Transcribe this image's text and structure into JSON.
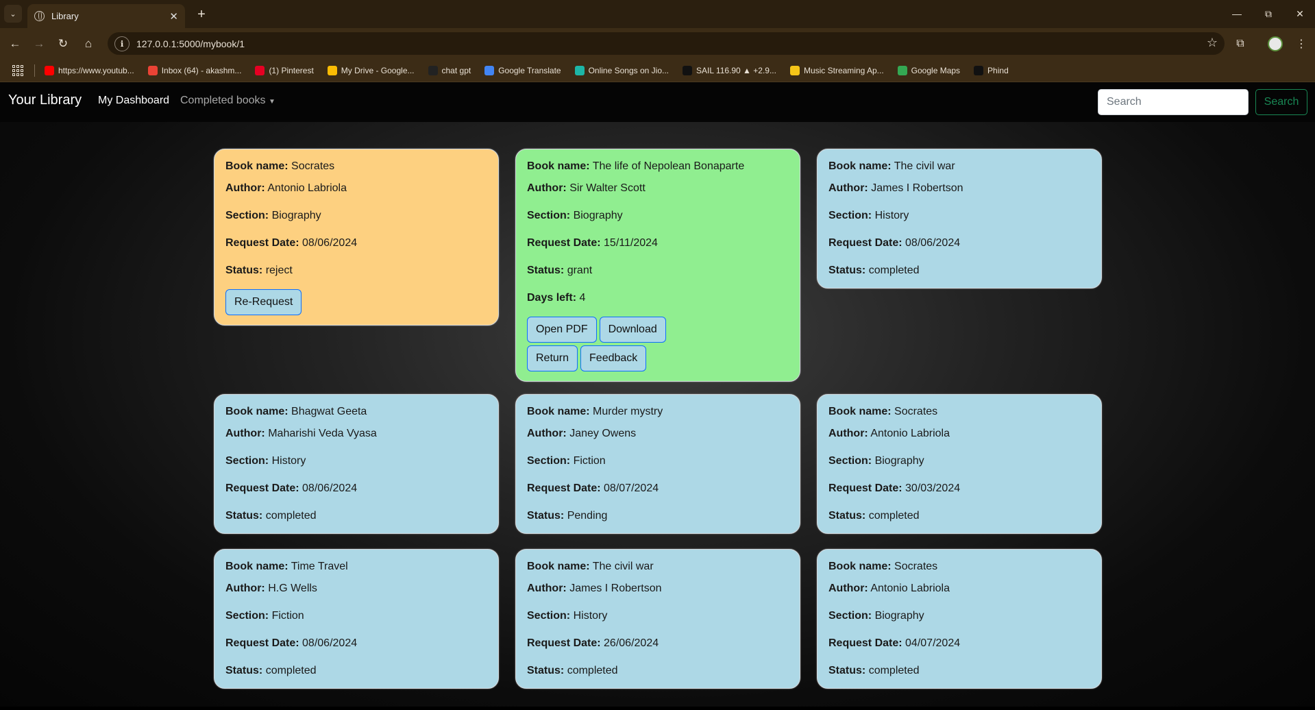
{
  "browser": {
    "tab_title": "Library",
    "url": "127.0.0.1:5000/mybook/1",
    "bookmarks": [
      {
        "label": "https://www.youtub...",
        "icon": "youtube-icon",
        "color": "#ff0000"
      },
      {
        "label": "Inbox (64) - akashm...",
        "icon": "gmail-icon",
        "color": "#ea4335"
      },
      {
        "label": "(1) Pinterest",
        "icon": "pinterest-icon",
        "color": "#e60023"
      },
      {
        "label": "My Drive - Google...",
        "icon": "drive-icon",
        "color": "#fbbc04"
      },
      {
        "label": "chat gpt",
        "icon": "chatgpt-icon",
        "color": "#222222"
      },
      {
        "label": "Google Translate",
        "icon": "translate-icon",
        "color": "#4285f4"
      },
      {
        "label": "Online Songs on Jio...",
        "icon": "jiosaavn-icon",
        "color": "#1db6a7"
      },
      {
        "label": "SAIL 116.90 ▲ +2.9...",
        "icon": "tradingview-icon",
        "color": "#111111"
      },
      {
        "label": "Music Streaming Ap...",
        "icon": "music-icon",
        "color": "#f5c518"
      },
      {
        "label": "Google Maps",
        "icon": "maps-icon",
        "color": "#34a853"
      },
      {
        "label": "Phind",
        "icon": "phind-icon",
        "color": "#111111"
      }
    ]
  },
  "navbar": {
    "brand": "Your Library",
    "dashboard": "My Dashboard",
    "completed": "Completed books",
    "search_placeholder": "Search",
    "search_button": "Search"
  },
  "labels": {
    "book_name": "Book name:",
    "author": "Author:",
    "section": "Section:",
    "request_date": "Request Date:",
    "status": "Status:",
    "days_left": "Days left:"
  },
  "colors": {
    "reject": "#fdd080",
    "grant": "#90ee90",
    "completed": "#add8e6"
  },
  "cards": [
    {
      "book": "Socrates",
      "author": "Antonio Labriola",
      "section": "Biography",
      "date": "08/06/2024",
      "status": "reject",
      "button": "Re-Request"
    },
    {
      "book": "The life of Nepolean Bonaparte",
      "author": "Sir Walter Scott",
      "section": "Biography",
      "date": "15/11/2024",
      "status": "grant",
      "days_left": "4",
      "buttons": [
        "Open PDF",
        "Download",
        "Return",
        "Feedback"
      ]
    },
    {
      "book": "The civil war",
      "author": "James I Robertson",
      "section": "History",
      "date": "08/06/2024",
      "status": "completed"
    },
    {
      "book": "Bhagwat Geeta",
      "author": "Maharishi Veda Vyasa",
      "section": "History",
      "date": "08/06/2024",
      "status": "completed"
    },
    {
      "book": "Murder mystry",
      "author": "Janey Owens",
      "section": "Fiction",
      "date": "08/07/2024",
      "status": "Pending"
    },
    {
      "book": "Socrates",
      "author": "Antonio Labriola",
      "section": "Biography",
      "date": "30/03/2024",
      "status": "completed"
    },
    {
      "book": "Time Travel",
      "author": "H.G Wells",
      "section": "Fiction",
      "date": "08/06/2024",
      "status": "completed"
    },
    {
      "book": "The civil war",
      "author": "James I Robertson",
      "section": "History",
      "date": "26/06/2024",
      "status": "completed"
    },
    {
      "book": "Socrates",
      "author": "Antonio Labriola",
      "section": "Biography",
      "date": "04/07/2024",
      "status": "completed"
    }
  ]
}
